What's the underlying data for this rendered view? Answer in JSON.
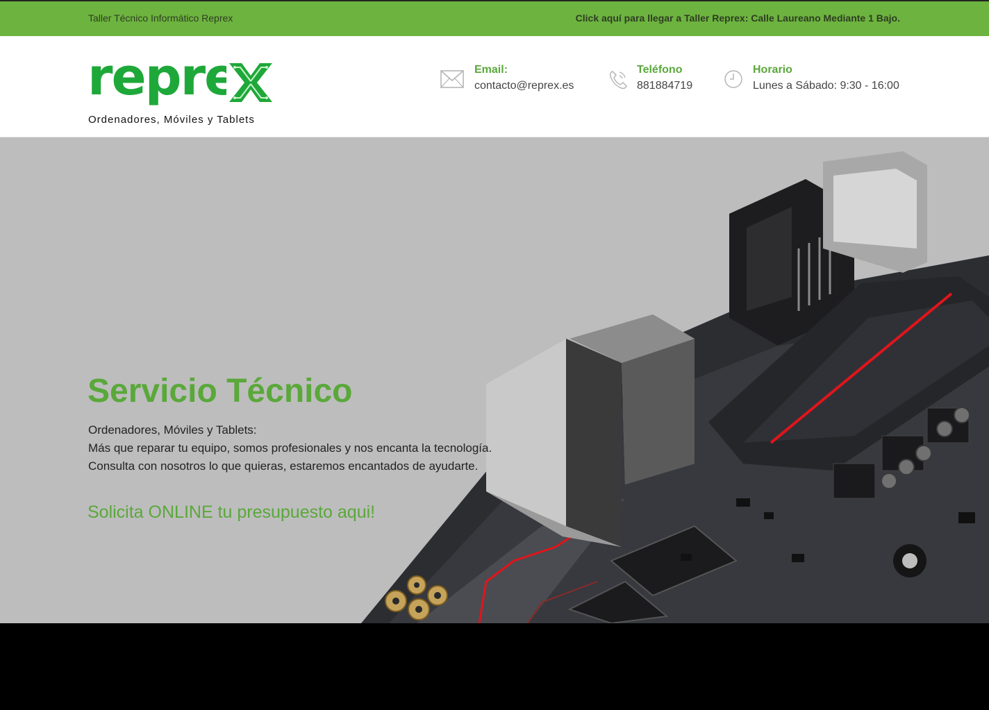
{
  "topbar": {
    "left_text": "Taller Técnico Informático Reprex",
    "right_link": "Click aquí para llegar a Taller Reprex: Calle Laureano Mediante 1 Bajo."
  },
  "logo": {
    "wordmark": "reprex",
    "tagline": "Ordenadores, Móviles y Tablets"
  },
  "contacts": [
    {
      "icon": "envelope-icon",
      "label": "Email:",
      "value": "contacto@reprex.es"
    },
    {
      "icon": "phone-icon",
      "label": "Teléfono",
      "value": "881884719"
    },
    {
      "icon": "clock-icon",
      "label": "Horario",
      "value": "Lunes a Sábado: 9:30 - 16:00"
    }
  ],
  "hero": {
    "title": "Servicio Técnico",
    "lines": [
      "Ordenadores, Móviles y Tablets:",
      "Más que reparar tu equipo, somos profesionales y nos encanta la tecnología.",
      "Consulta con nosotros lo que quieras, estaremos encantados de ayudarte."
    ],
    "cta": "Solicita ONLINE tu presupuesto aqui!",
    "image": "motherboard-image"
  },
  "colors": {
    "accent_green": "#6db33f",
    "text_green": "#5aa83a",
    "logo_green": "#1fa83a",
    "hero_bg": "#bdbdbd",
    "board_red": "#e0151b"
  }
}
